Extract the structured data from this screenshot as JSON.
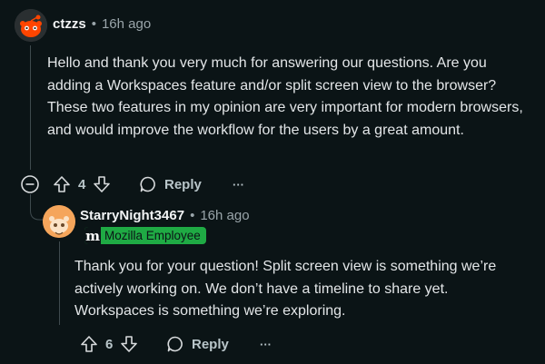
{
  "comments": [
    {
      "username": "ctzzs",
      "time": "16h ago",
      "body": "Hello and thank you very much for answering our questions. Are you adding a Workspaces feature and/or split screen view to the browser? These two features in my opinion are very important for modern browsers, and would improve the workflow for the users by a great amount.",
      "votes": "4",
      "reply_label": "Reply",
      "more_label": "···"
    },
    {
      "username": "StarryNight3467",
      "time": "16h ago",
      "flair_letter": "m",
      "flair_text": "Mozilla Employee",
      "body": "Thank you for your question! Split screen view is something we’re actively working on. We don’t have a timeline to share yet. Workspaces is something we’re exploring.",
      "votes": "6",
      "reply_label": "Reply",
      "more_label": "···"
    }
  ],
  "separator": "•",
  "colors": {
    "background": "#0b1416",
    "flair_green": "#1faa44",
    "avatar1": "#ff4500",
    "avatar2": "#f5a55b"
  },
  "icons": [
    "collapse-icon",
    "upvote-icon",
    "downvote-icon",
    "reply-comment-icon",
    "more-options-icon",
    "snoo-avatar"
  ]
}
